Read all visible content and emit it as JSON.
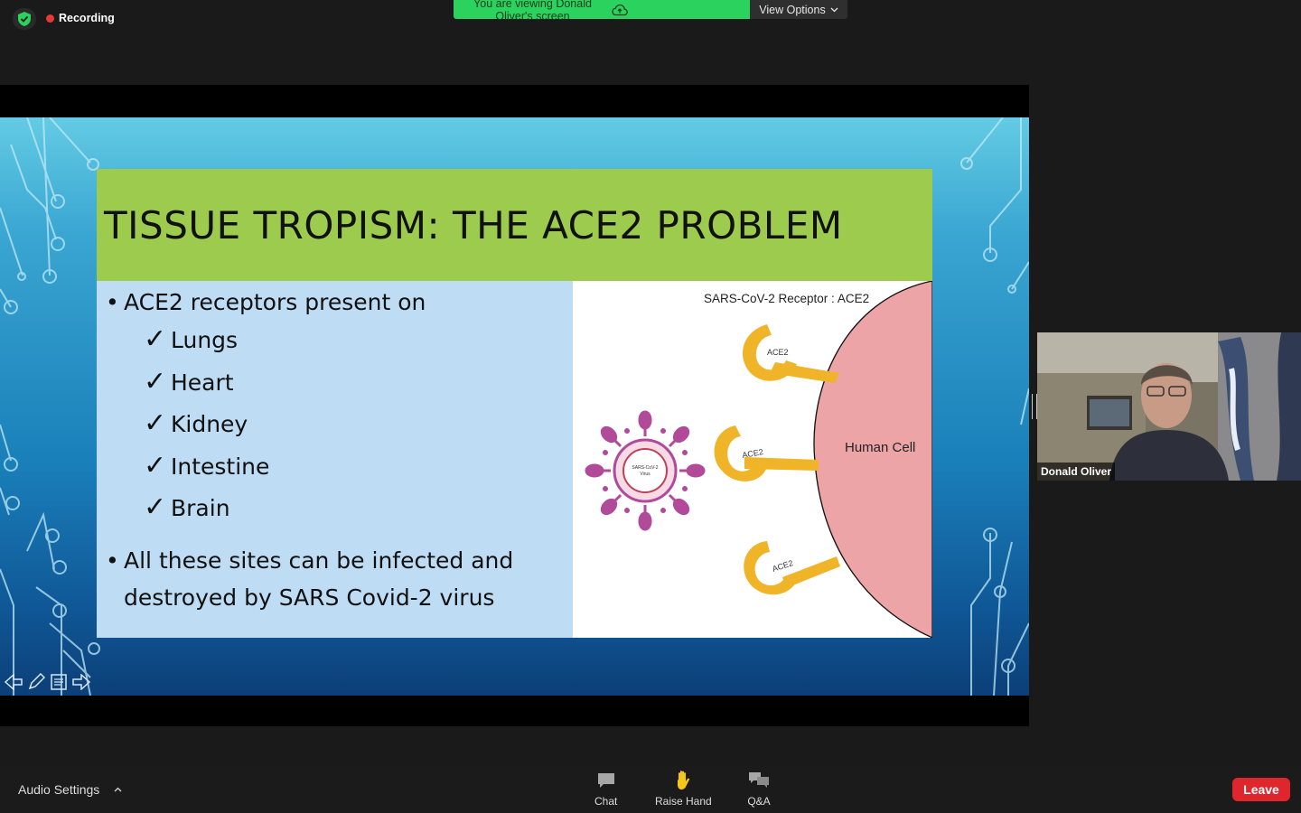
{
  "top": {
    "recording_label": "Recording",
    "banner_text": "You are viewing Donald Oliver's screen",
    "view_options_label": "View Options",
    "icons": [
      "shield-check-icon",
      "cloud-upload-icon",
      "chevron-down-icon"
    ]
  },
  "slide": {
    "title": "TISSUE TROPISM: THE ACE2 PROBLEM",
    "bullet1": "ACE2 receptors present on",
    "organs": [
      "Lungs",
      "Heart",
      "Kidney",
      "Intestine",
      "Brain"
    ],
    "bullet2_line1": "All these sites can be infected and",
    "bullet2_line2": "destroyed by SARS Covid-2 virus",
    "image_title": "SARS-CoV-2 Receptor : ACE2",
    "human_cell_label": "Human Cell",
    "receptor_label": "ACE2",
    "virus_label_line1": "SARS-CoV-2",
    "virus_label_line2": "Virus"
  },
  "video": {
    "participant_name": "Donald Oliver"
  },
  "toolbar": {
    "audio_settings_label": "Audio Settings",
    "chat_label": "Chat",
    "raise_hand_label": "Raise Hand",
    "qa_label": "Q&A",
    "leave_label": "Leave"
  },
  "colors": {
    "banner_green": "#2bd35e",
    "title_band_green": "#9ccb4e",
    "content_blue": "#bedcf3",
    "receptor_yellow": "#f0b429",
    "cell_pink": "#eda4a6",
    "virus_magenta": "#b24a9a",
    "leave_red": "#e0262d"
  }
}
